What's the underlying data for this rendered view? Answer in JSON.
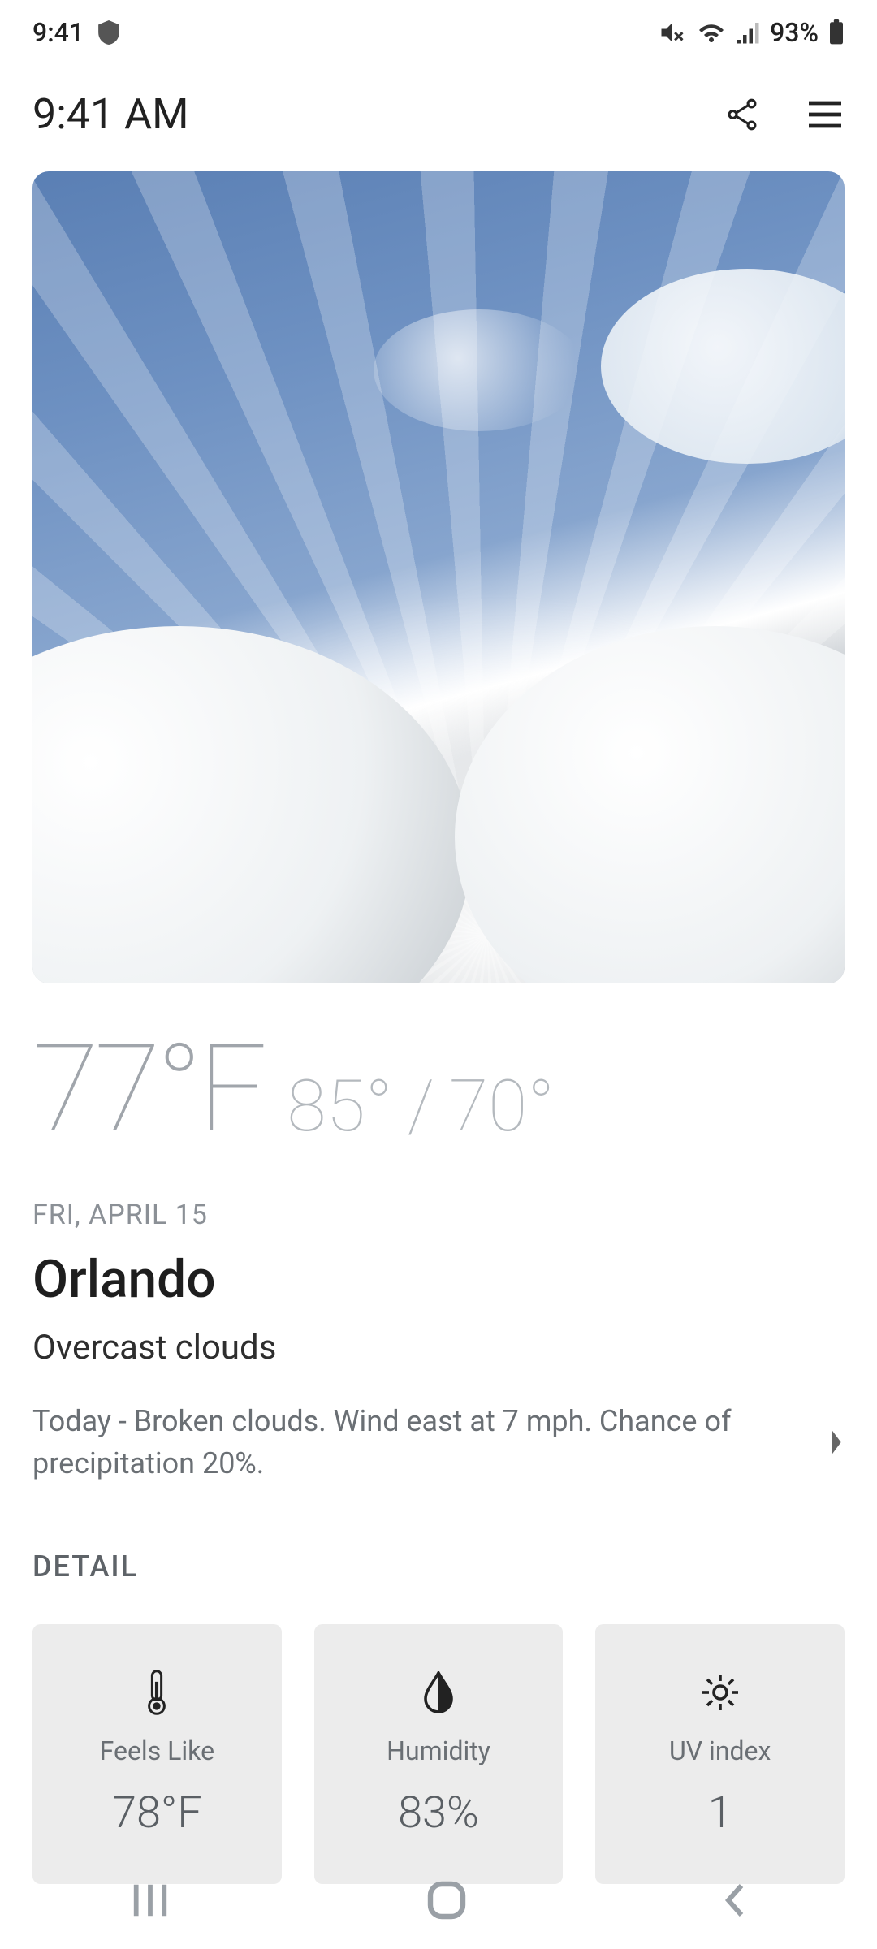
{
  "status": {
    "time": "9:41",
    "battery": "93%"
  },
  "header": {
    "time": "9:41 AM"
  },
  "weather": {
    "current_temp": "77°F",
    "high": "85°",
    "low": "70°",
    "date": "FRI, APRIL 15",
    "city": "Orlando",
    "condition": "Overcast clouds",
    "forecast": "Today - Broken clouds. Wind east at 7 mph. Chance of precipitation 20%."
  },
  "detail": {
    "heading": "DETAIL",
    "cards": [
      {
        "label": "Feels Like",
        "value": "78°F",
        "icon": "thermometer"
      },
      {
        "label": "Humidity",
        "value": "83%",
        "icon": "droplet"
      },
      {
        "label": "UV index",
        "value": "1",
        "icon": "sun"
      }
    ]
  }
}
